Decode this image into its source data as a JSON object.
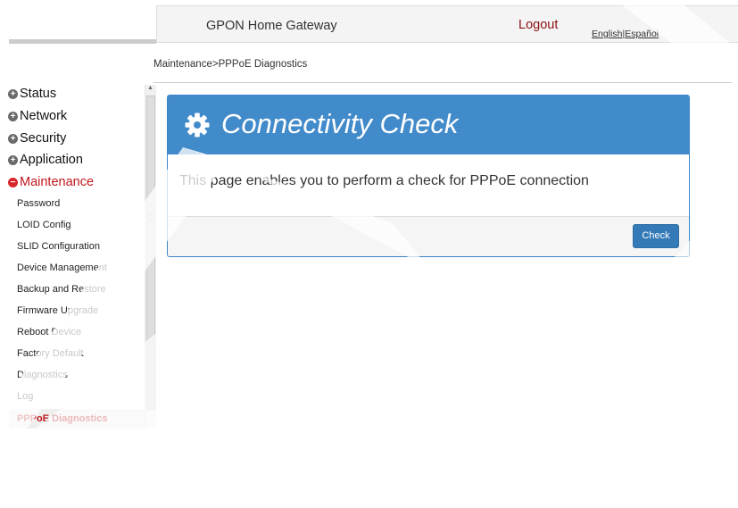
{
  "header": {
    "brand": "GPON Home Gateway",
    "logout": "Logout",
    "lang_english": "English",
    "lang_separator": "|",
    "lang_espanol": "Español"
  },
  "breadcrumb": "Maintenance>PPPoE Diagnostics",
  "sidebar": {
    "groups": [
      {
        "label": "Status",
        "icon": "plus-circle-icon"
      },
      {
        "label": "Network",
        "icon": "plus-circle-icon"
      },
      {
        "label": "Security",
        "icon": "plus-circle-icon"
      },
      {
        "label": "Application",
        "icon": "plus-circle-icon"
      },
      {
        "label": "Maintenance",
        "icon": "minus-circle-icon",
        "expanded": true
      }
    ],
    "items": [
      {
        "label": "Password"
      },
      {
        "label": "LOID Config"
      },
      {
        "label": "SLID Configuration"
      },
      {
        "label": "Device Management"
      },
      {
        "label": "Backup and Restore"
      },
      {
        "label": "Firmware Upgrade"
      },
      {
        "label": "Reboot Device"
      },
      {
        "label": "Factory Default"
      },
      {
        "label": "Diagnostics"
      },
      {
        "label": "Log"
      },
      {
        "label": "PPPoE Diagnostics",
        "selected": true
      }
    ]
  },
  "panel": {
    "icon": "gear-icon",
    "title": "Connectivity Check",
    "description": "This page enables you to perform a check for PPPoE connection",
    "button": "Check"
  },
  "colors": {
    "accent_red": "#c0161c",
    "header_blue": "#428bca",
    "button_blue": "#337ab7"
  }
}
